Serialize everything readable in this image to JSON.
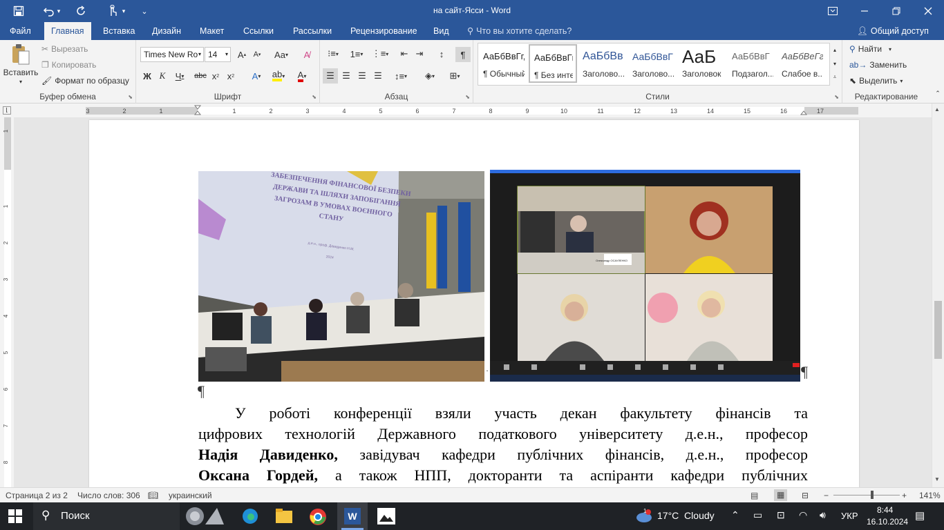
{
  "window": {
    "title": "на сайт-Ясси - Word"
  },
  "tabs": [
    {
      "label": "Файл"
    },
    {
      "label": "Главная"
    },
    {
      "label": "Вставка"
    },
    {
      "label": "Дизайн"
    },
    {
      "label": "Макет"
    },
    {
      "label": "Ссылки"
    },
    {
      "label": "Рассылки"
    },
    {
      "label": "Рецензирование"
    },
    {
      "label": "Вид"
    }
  ],
  "tell_me": "Что вы хотите сделать?",
  "share": "Общий доступ",
  "ribbon": {
    "clipboard": {
      "paste": "Вставить",
      "cut": "Вырезать",
      "copy": "Копировать",
      "format_painter": "Формат по образцу",
      "label": "Буфер обмена"
    },
    "font": {
      "family": "Times New Ro",
      "size": "14",
      "label": "Шрифт"
    },
    "paragraph": {
      "label": "Абзац"
    },
    "styles": {
      "label": "Стили",
      "items": [
        {
          "sample": "АаБбВвГг,",
          "name": "¶ Обычный"
        },
        {
          "sample": "АаБбВвГг,",
          "name": "¶ Без инте..."
        },
        {
          "sample": "АаБбВв",
          "name": "Заголово..."
        },
        {
          "sample": "АаБбВвГ",
          "name": "Заголово..."
        },
        {
          "sample": "АаБ",
          "name": "Заголовок"
        },
        {
          "sample": "АаБбВвГ",
          "name": "Подзагол..."
        },
        {
          "sample": "АаБбВеГг",
          "name": "Слабое в..."
        }
      ]
    },
    "editing": {
      "find": "Найти",
      "replace": "Заменить",
      "select": "Выделить",
      "label": "Редактирование"
    }
  },
  "ruler": {
    "marks": [
      "3",
      "2",
      "1",
      "1",
      "2",
      "3",
      "4",
      "5",
      "6",
      "7",
      "8",
      "9",
      "10",
      "11",
      "12",
      "13",
      "14",
      "15",
      "16",
      "17"
    ]
  },
  "vruler": {
    "marks": [
      "1",
      "1",
      "2",
      "3",
      "4",
      "5",
      "6",
      "7",
      "8"
    ]
  },
  "document": {
    "slide_text": "ЗАБЕЗПЕЧЕННЯ ФІНАНСОВОЇ БЕЗПЕКИ ДЕРЖАВИ ТА ШЛЯХИ ЗАПОБІГАННЯ ЗАГРОЗАМ В УМОВАХ ВОЄННОГО СТАНУ",
    "slide_author": "д.е.н., проф. Давиденко Н.М.",
    "slide_year": "2024",
    "zoom_caption": "Олександр ОСАУЛЕНКО",
    "lines": [
      "У роботі конференції взяли участь декан факультету фінансів та",
      "цифрових технологій Державного податкового університету д.е.н., професор",
      "Надія Давиденко, завідувач кафедри публічних фінансів, д.е.н., професор",
      "Оксана Гордей, а також НПП, докторанти та аспіранти кафедри публічних"
    ]
  },
  "status": {
    "page": "Страница 2 из 2",
    "words": "Число слов: 306",
    "language": "украинский",
    "zoom": "141%",
    "zoom_fraction": 0.58
  },
  "taskbar": {
    "search": "Поиск",
    "weather": "17°C  Cloudy",
    "weather_badge": "1",
    "lang": "УКР",
    "time": "8:44",
    "date": "16.10.2024"
  },
  "colors": {
    "accent": "#2b579a",
    "taskbar": "#1f2226"
  }
}
